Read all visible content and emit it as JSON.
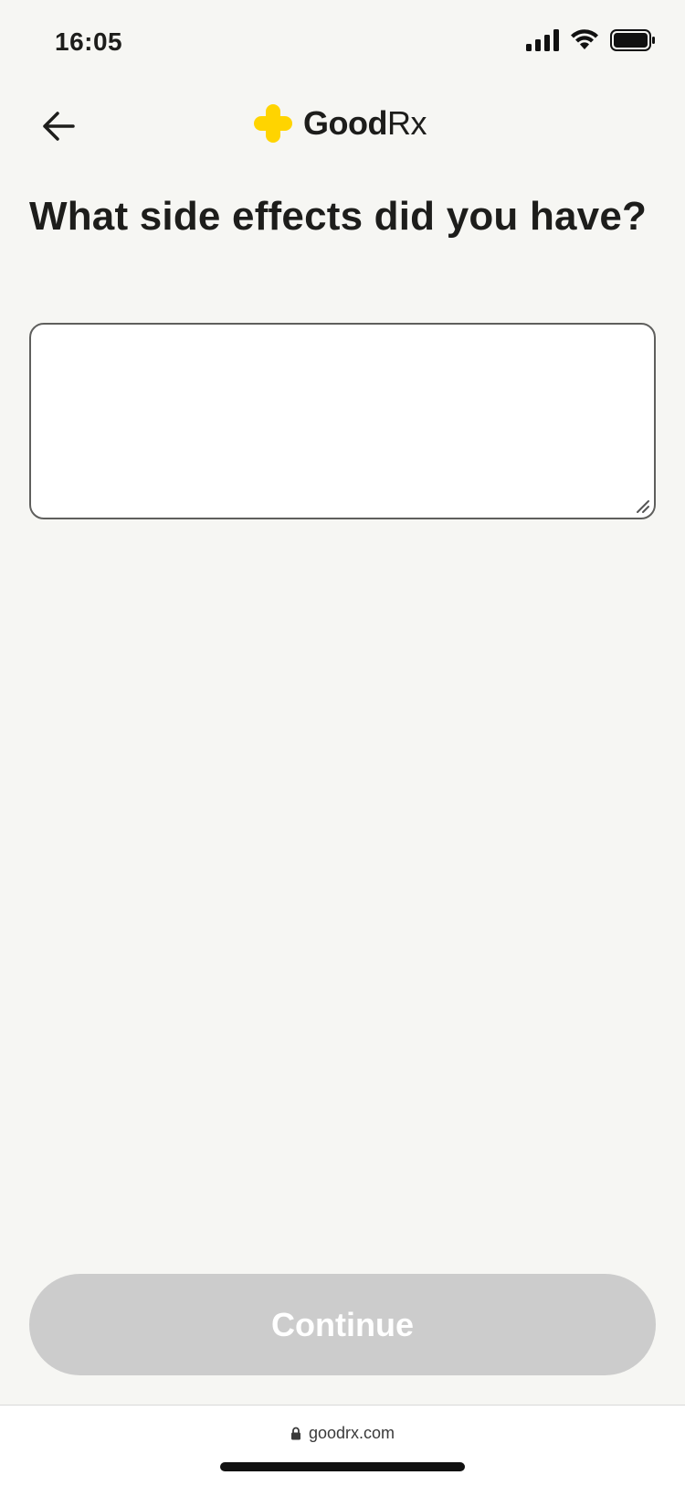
{
  "status_bar": {
    "time": "16:05"
  },
  "header": {
    "brand_bold": "Good",
    "brand_light": "Rx",
    "logo_color": "#FFD400"
  },
  "main": {
    "question": "What side effects did you have?",
    "input_value": "",
    "input_placeholder": ""
  },
  "footer": {
    "continue_label": "Continue",
    "continue_bg": "#CCCCCC"
  },
  "browser": {
    "url": "goodrx.com"
  }
}
